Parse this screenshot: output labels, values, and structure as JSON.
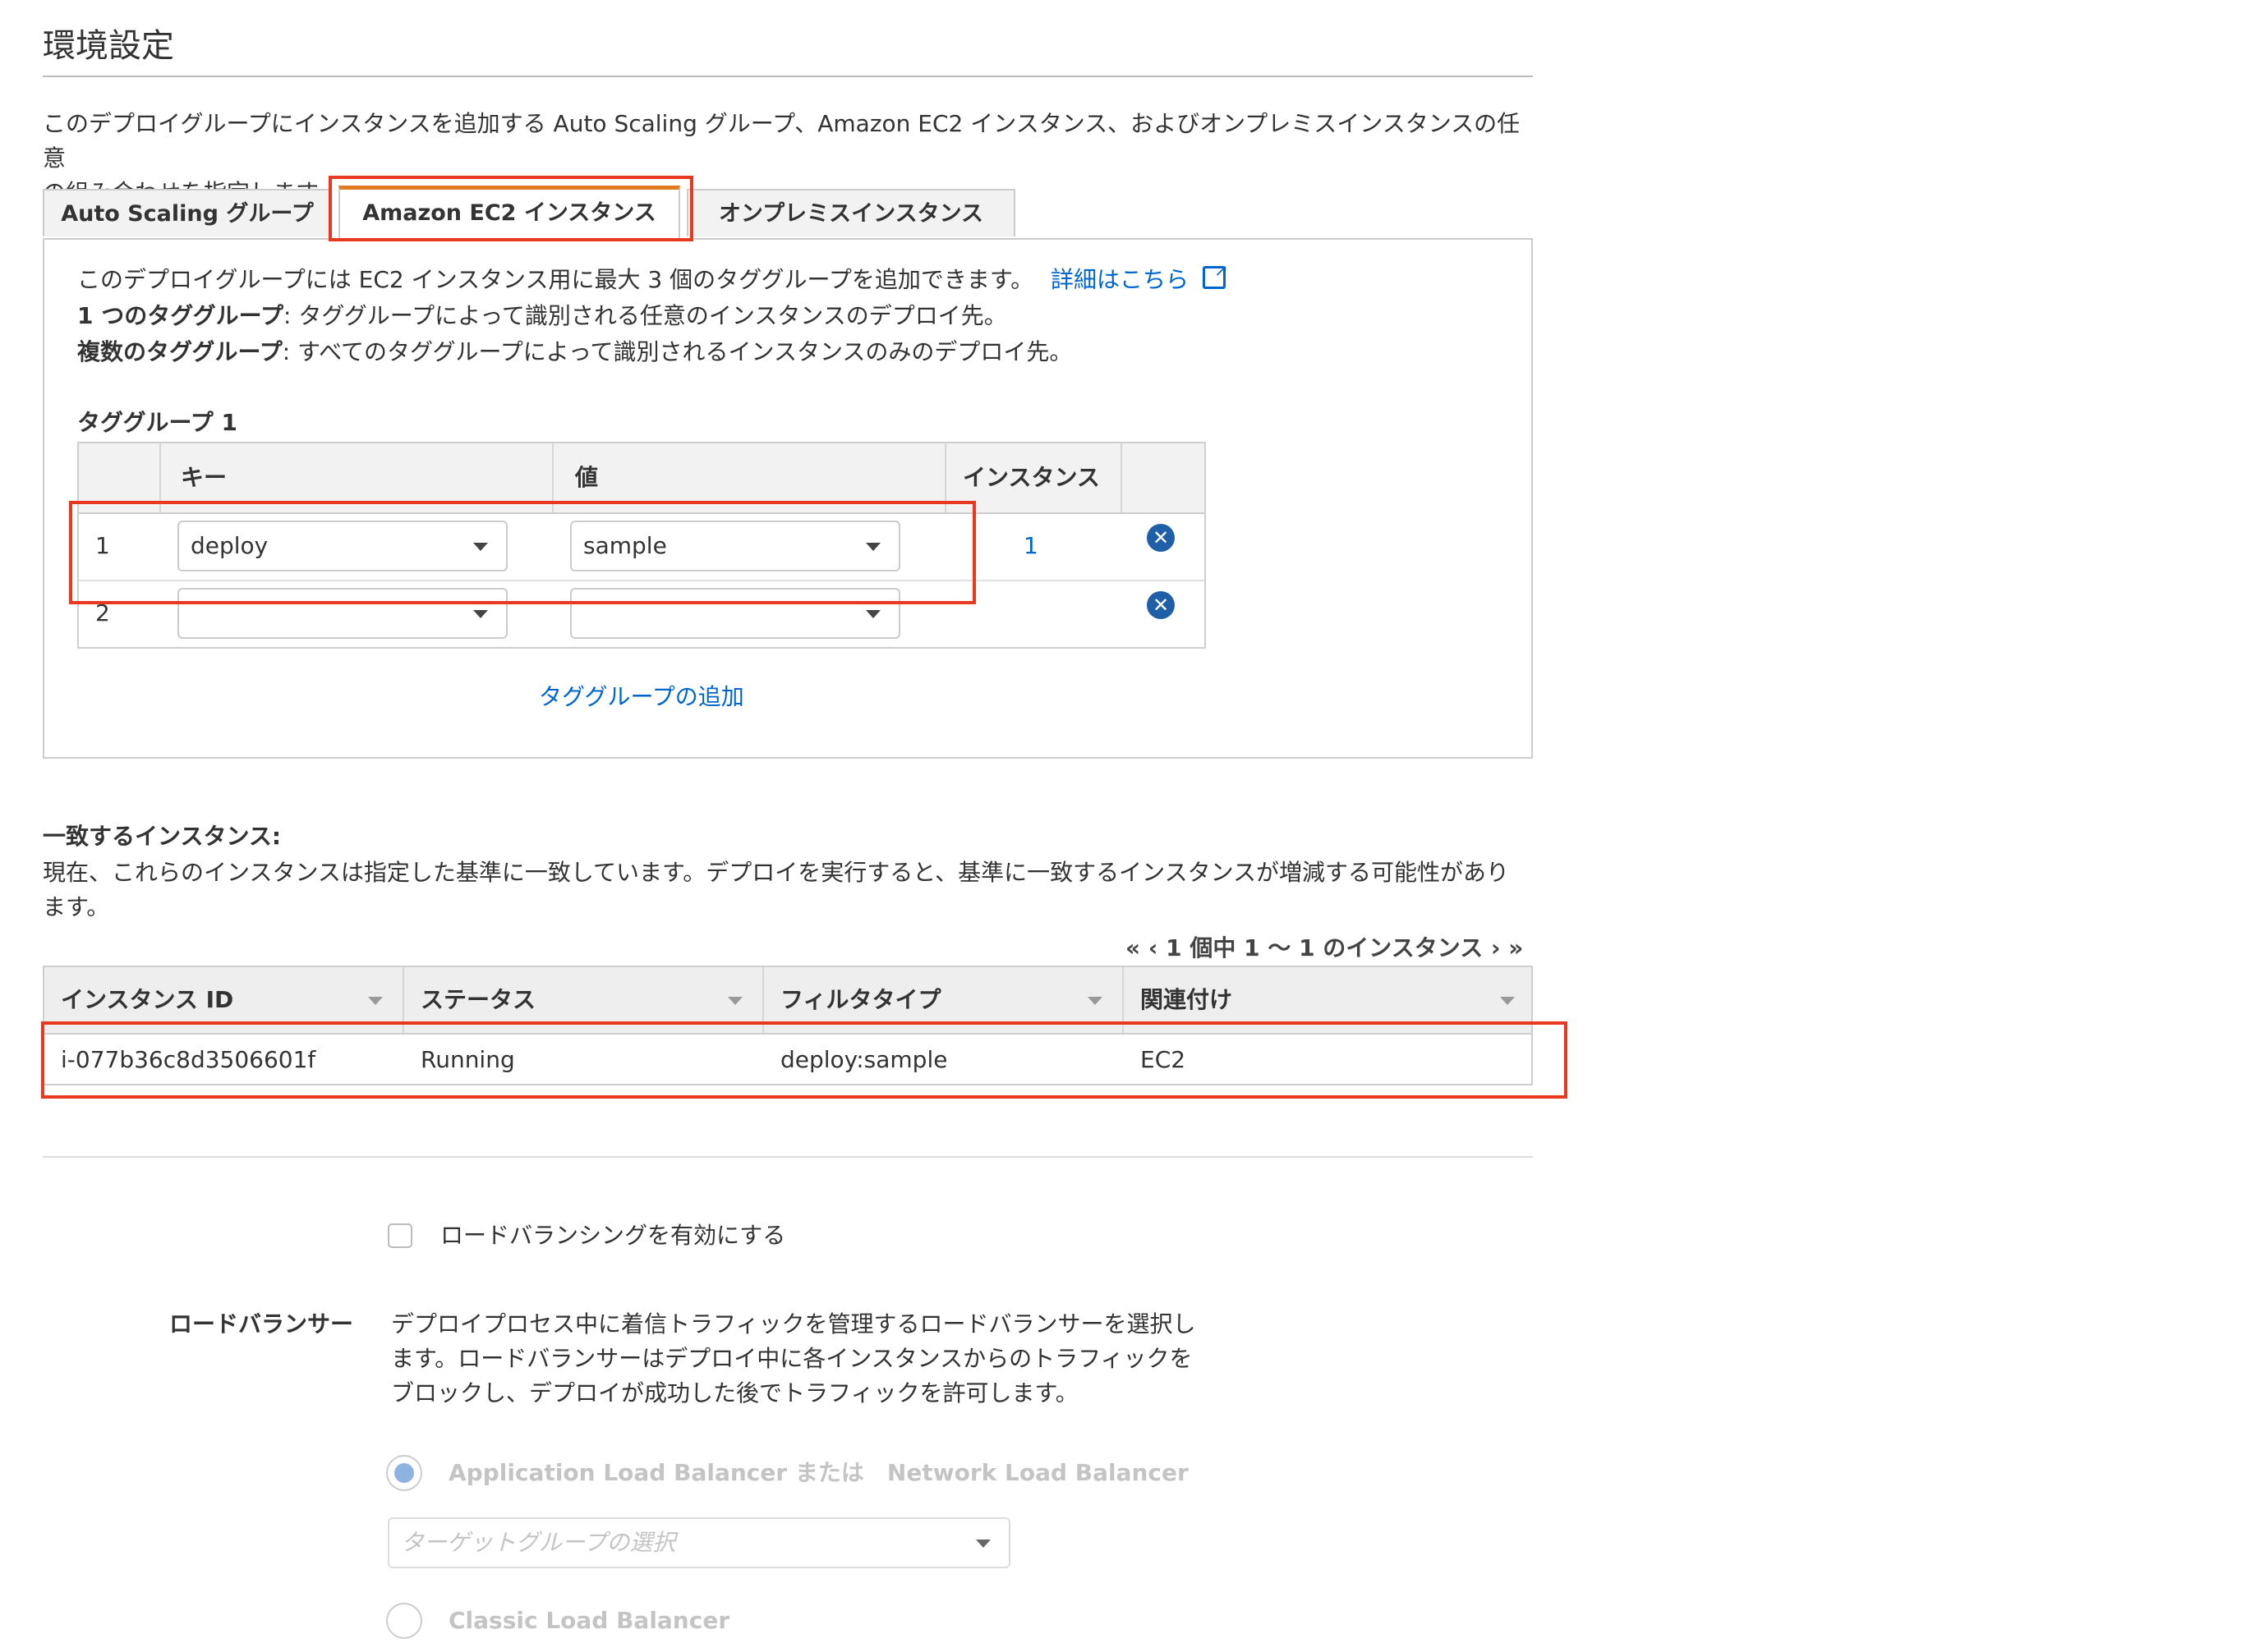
{
  "header": {
    "title": "環境設定",
    "intro_line1": "このデプロイグループにインスタンスを追加する Auto Scaling グループ、Amazon EC2 インスタンス、およびオンプレミスインスタンスの任意",
    "intro_line2": "の組み合わせを指定します。"
  },
  "tabs": [
    {
      "label": "Auto Scaling グループ",
      "active": false
    },
    {
      "label": "Amazon EC2 インスタンス",
      "active": true
    },
    {
      "label": "オンプレミスインスタンス",
      "active": false
    }
  ],
  "panel": {
    "desc1": "このデプロイグループには EC2 インスタンス用に最大 3 個のタググループを追加できます。",
    "learn_more": "詳細はこちら",
    "single_label": "1 つのタググループ",
    "single_desc": ": タググループによって識別される任意のインスタンスのデプロイ先。",
    "multi_label": "複数のタググループ",
    "multi_desc": ": すべてのタググループによって識別されるインスタンスのみのデプロイ先。",
    "tag_group_title": "タググループ 1",
    "add_tag_group": "タググループの追加"
  },
  "tag_table": {
    "headers": {
      "key": "キー",
      "value": "値",
      "instances": "インスタンス"
    },
    "rows": [
      {
        "num": "1",
        "key": "deploy",
        "value": "sample",
        "instances": "1"
      },
      {
        "num": "2",
        "key": "",
        "value": "",
        "instances": ""
      }
    ],
    "remove_glyph": "✕"
  },
  "matching": {
    "title": "一致するインスタンス:",
    "desc_line1": "現在、これらのインスタンスは指定した基準に一致しています。デプロイを実行すると、基準に一致するインスタンスが増減する可能性があり",
    "desc_line2": "ます。",
    "pager": "« ‹ 1 個中 1 〜 1 のインスタンス › »"
  },
  "instances_table": {
    "headers": [
      "インスタンス ID",
      "ステータス",
      "フィルタタイプ",
      "関連付け"
    ],
    "rows": [
      [
        "i-077b36c8d3506601f",
        "Running",
        "deploy:sample",
        "EC2"
      ]
    ]
  },
  "load_balancing": {
    "enable_label": "ロードバランシングを有効にする",
    "enabled": false,
    "lb_label": "ロードバランサー",
    "lb_desc_line1": "デプロイプロセス中に着信トラフィックを管理するロードバランサーを選択し",
    "lb_desc_line2": "ます。ロードバランサーはデプロイ中に各インスタンスからのトラフィックを",
    "lb_desc_line3": "ブロックし、デプロイが成功した後でトラフィックを許可します。",
    "option_alb": "Application Load Balancer または　Network Load Balancer",
    "target_group_placeholder": "ターゲットグループの選択",
    "option_classic": "Classic Load Balancer"
  },
  "colors": {
    "accent_tab": "#e07b20",
    "link": "#0066cc",
    "highlight": "#e8381f",
    "remove_icon": "#1f5fa8"
  }
}
